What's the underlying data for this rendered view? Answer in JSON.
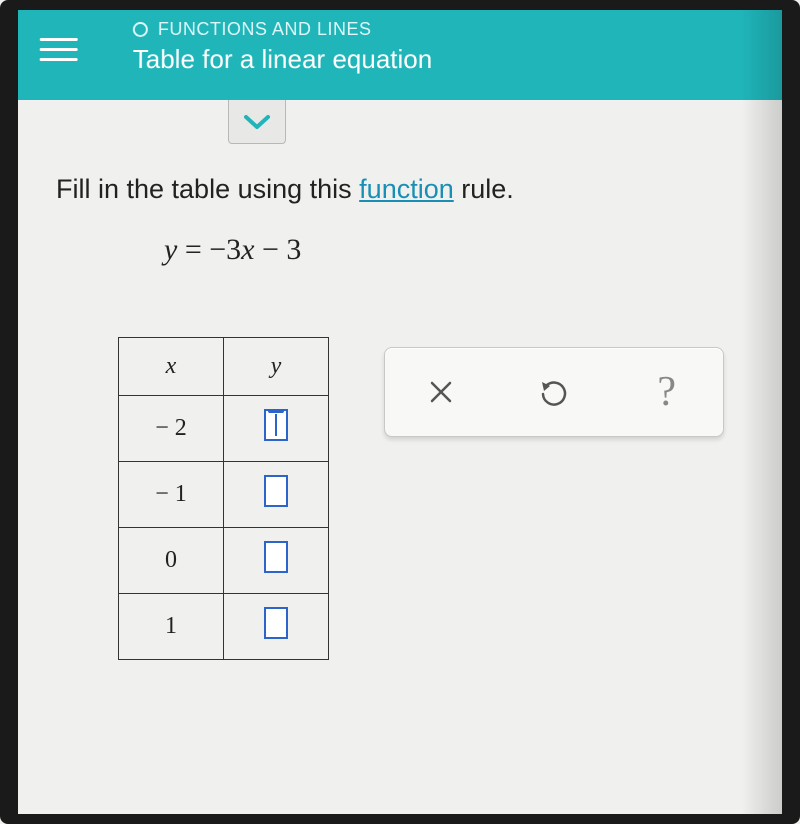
{
  "header": {
    "section": "FUNCTIONS AND LINES",
    "title": "Table for a linear equation"
  },
  "instruction": {
    "pre": "Fill in the table using this ",
    "link": "function",
    "post": " rule."
  },
  "equation_display": "y = −3x − 3",
  "chart_data": {
    "type": "table",
    "columns": [
      "x",
      "y"
    ],
    "rows": [
      {
        "x": "− 2",
        "y": ""
      },
      {
        "x": "− 1",
        "y": ""
      },
      {
        "x": "0",
        "y": ""
      },
      {
        "x": "1",
        "y": ""
      }
    ],
    "active_row": 0
  },
  "toolbar": {
    "clear": "×",
    "reset": "↶",
    "help": "?"
  }
}
